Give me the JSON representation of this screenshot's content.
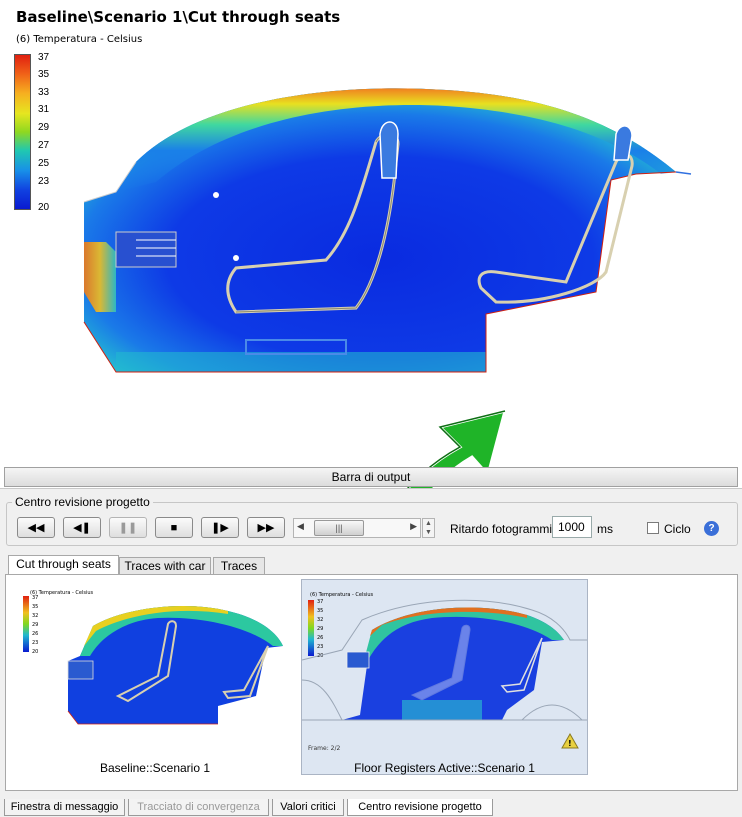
{
  "viewport": {
    "title": "Baseline\\Scenario 1\\Cut through seats",
    "subtitle": "(6) Temperatura - Celsius",
    "legend_labels": [
      "37",
      "35",
      "33",
      "31",
      "29",
      "27",
      "25",
      "23",
      "20"
    ]
  },
  "output_bar": {
    "label": "Barra di output"
  },
  "review": {
    "group_label": "Centro revisione progetto",
    "buttons": [
      {
        "name": "rewind",
        "glyph": "◀◀"
      },
      {
        "name": "step-back",
        "glyph": "◀❚"
      },
      {
        "name": "pause",
        "glyph": "❚❚"
      },
      {
        "name": "stop",
        "glyph": "■"
      },
      {
        "name": "step-forward",
        "glyph": "❚▶"
      },
      {
        "name": "fast-forward",
        "glyph": "▶▶"
      }
    ],
    "delay_label": "Ritardo fotogrammi:",
    "delay_value": "1000",
    "delay_unit": "ms",
    "loop_label": "Ciclo",
    "loop_checked": false
  },
  "tabs": [
    "Cut through seats",
    "Traces with car",
    "Traces"
  ],
  "active_tab": "Cut through seats",
  "thumbnails": [
    {
      "label": "Baseline::Scenario 1",
      "legend_title": "(6) Temperatura - Celsius",
      "legend_labels": [
        "37",
        "35",
        "32",
        "29",
        "26",
        "23",
        "20"
      ]
    },
    {
      "label": "Floor Registers Active::Scenario 1",
      "legend_title": "(6) Temperatura - Celsius",
      "legend_labels": [
        "37",
        "35",
        "32",
        "29",
        "26",
        "23",
        "20"
      ],
      "frame": "Frame: 2/2"
    }
  ],
  "bottom_tabs": [
    {
      "label": "Finestra di messaggio",
      "state": "normal"
    },
    {
      "label": "Tracciato di convergenza",
      "state": "disabled"
    },
    {
      "label": "Valori critici",
      "state": "normal"
    },
    {
      "label": "Centro revisione progetto",
      "state": "active"
    }
  ]
}
